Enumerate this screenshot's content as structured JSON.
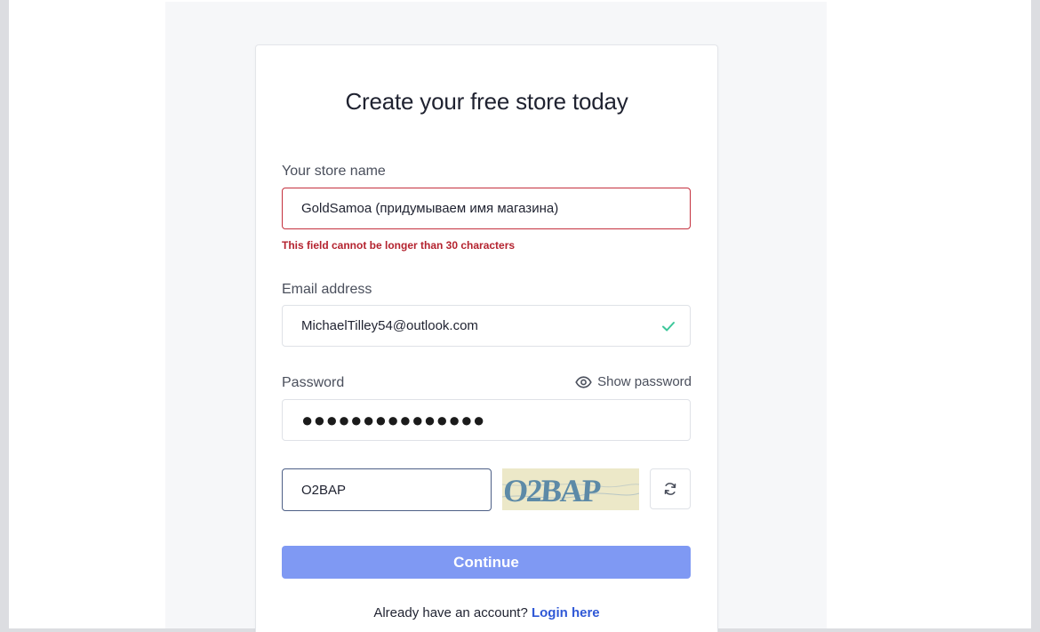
{
  "form": {
    "title": "Create your free store today",
    "store_name": {
      "label": "Your store name",
      "value": "GoldSamoa (придумываем имя магазина)",
      "error": "This field cannot be longer than 30 characters"
    },
    "email": {
      "label": "Email address",
      "value": "MichaelTilley54@outlook.com",
      "valid_icon": "check-icon"
    },
    "password": {
      "label": "Password",
      "show_label": "Show password",
      "masked_value": "●●●●●●●●●●●●●●●"
    },
    "captcha": {
      "input_value": "O2BAP",
      "image_text": "O2BAP",
      "refresh_icon": "refresh-icon"
    },
    "continue_label": "Continue",
    "footer": {
      "text": "Already have an account?",
      "link": "Login here"
    }
  },
  "colors": {
    "error": "#c4303e",
    "accent": "#7f99f3",
    "link": "#2f58d6",
    "valid": "#3cc79a"
  }
}
